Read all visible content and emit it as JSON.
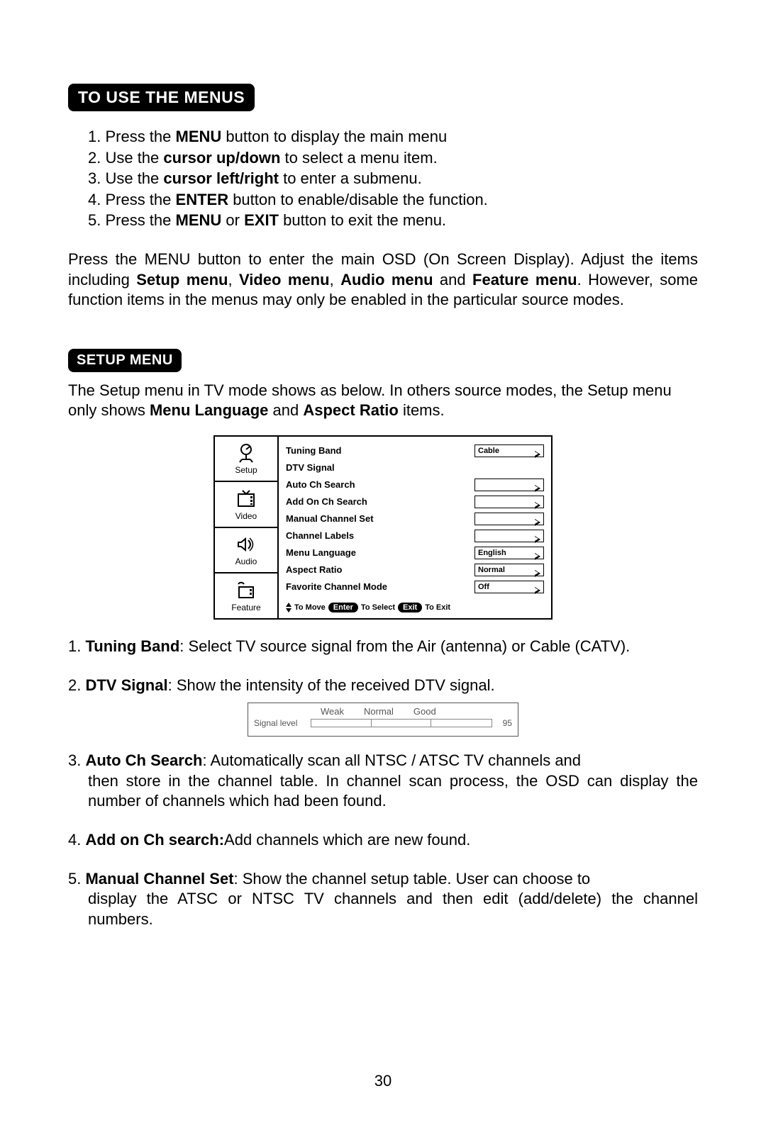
{
  "headings": {
    "to_use_menus": "TO USE THE MENUS",
    "setup_menu": "SETUP MENU"
  },
  "steps": {
    "s1_pre": "1.   Press the ",
    "s1_b": "MENU",
    "s1_post": " button to display the main menu",
    "s2_pre": "2.   Use the ",
    "s2_b": "cursor up/down",
    "s2_post": " to select a menu item.",
    "s3_pre": "3.   Use the ",
    "s3_b": "cursor left/right",
    "s3_post": " to enter a submenu.",
    "s4_pre": "4.   Press the ",
    "s4_b": "ENTER",
    "s4_post": " button to enable/disable the function.",
    "s5_pre": "5.   Press the ",
    "s5_b1": "MENU",
    "s5_mid": " or ",
    "s5_b2": "EXIT",
    "s5_post": " button to exit the menu."
  },
  "osd_paragraph": {
    "pre": "Press the MENU button to enter the main OSD (On Screen Display). Adjust the items including ",
    "b1": "Setup menu",
    "c1": ", ",
    "b2": "Video menu",
    "c2": ", ",
    "b3": "Audio menu",
    "c3": " and ",
    "b4": "Feature menu",
    "post": ". However, some function items in the menus may only be enabled in the particular source modes."
  },
  "setup_desc": {
    "pre": "The Setup menu in TV mode shows as below. In others source modes, the Setup menu only shows ",
    "b1": "Menu Language",
    "mid": " and ",
    "b2": "Aspect Ratio",
    "post": " items."
  },
  "osd": {
    "side": {
      "setup": "Setup",
      "video": "Video",
      "audio": "Audio",
      "feature": "Feature"
    },
    "rows": [
      {
        "label": "Tuning Band",
        "value": "Cable"
      },
      {
        "label": "DTV Signal",
        "value": ""
      },
      {
        "label": "Auto Ch Search",
        "value": ""
      },
      {
        "label": "Add On Ch Search",
        "value": ""
      },
      {
        "label": "Manual Channel Set",
        "value": ""
      },
      {
        "label": "Channel Labels",
        "value": ""
      },
      {
        "label": "Menu Language",
        "value": "English"
      },
      {
        "label": "Aspect Ratio",
        "value": "Normal"
      },
      {
        "label": "Favorite Channel Mode",
        "value": "Off"
      }
    ],
    "footer": {
      "move": "To Move",
      "enter": "Enter",
      "select": "To Select",
      "exit": "Exit",
      "toexit": "To Exit"
    }
  },
  "details": {
    "d1_num": "1. ",
    "d1_b": "Tuning Band",
    "d1_post": ": Select TV source signal from the Air (antenna) or Cable (CATV).",
    "d2_num": "2. ",
    "d2_b": "DTV Signal",
    "d2_post": ": Show the intensity of the received DTV signal.",
    "d3_num": "3. ",
    "d3_b": "Auto Ch Search",
    "d3_post1": ": Automatically scan all NTSC / ATSC TV channels and",
    "d3_post2": "then store in the channel table. In channel scan process, the OSD can display the number of channels which had been found.",
    "d4_num": "4. ",
    "d4_b": "Add on Ch search:",
    "d4_post": "Add channels which are new found.",
    "d5_num": "5. ",
    "d5_b": "Manual Channel Set",
    "d5_post1": ": Show the channel setup table. User can choose to",
    "d5_post2": "display the ATSC or NTSC TV channels and then edit (add/delete) the channel numbers."
  },
  "signal": {
    "label": "Signal level",
    "weak": "Weak",
    "normal": "Normal",
    "good": "Good",
    "value": "95"
  },
  "page_number": "30"
}
